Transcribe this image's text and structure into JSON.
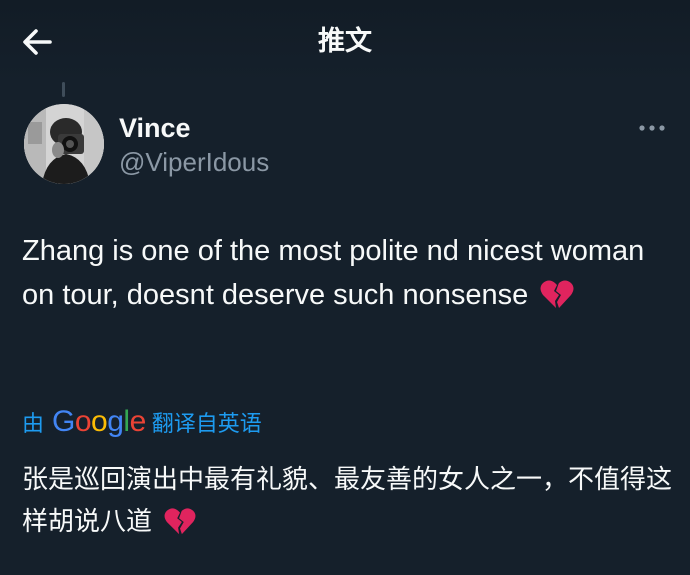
{
  "header": {
    "title": "推文",
    "back_icon": "arrow-left-icon"
  },
  "author": {
    "display_name": "Vince",
    "handle": "@ViperIdous",
    "avatar_icon": "profile-photo-camera"
  },
  "menu": {
    "more_icon": "ellipsis-icon"
  },
  "tweet": {
    "text": "Zhang is one of the most polite nd nicest woman on tour, doesnt deserve such nonsense",
    "emoji_icon": "broken-heart-icon"
  },
  "translation": {
    "prefix": "由",
    "provider": "Google",
    "suffix": "翻译自英语",
    "text": "张是巡回演出中最有礼貌、最友善的女人之一，不值得这样胡说八道"
  },
  "colors": {
    "background": "#15202b",
    "text_primary": "#f7f9f9",
    "text_secondary": "#8b98a5",
    "link": "#1d9bf0",
    "broken_heart": "#e0245e"
  }
}
